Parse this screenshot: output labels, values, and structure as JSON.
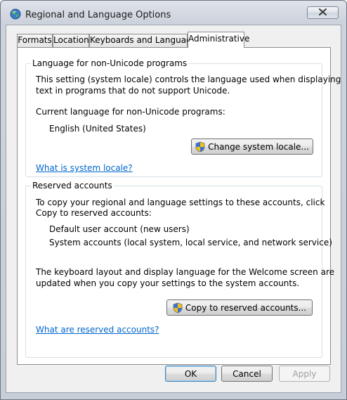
{
  "window": {
    "title": "Regional and Language Options"
  },
  "tabs": [
    {
      "label": "Formats"
    },
    {
      "label": "Location"
    },
    {
      "label": "Keyboards and Languages"
    },
    {
      "label": "Administrative"
    }
  ],
  "non_unicode": {
    "legend": "Language for non-Unicode programs",
    "description_line1": "This setting (system locale) controls the language used when displaying",
    "description_line2": "text in programs that do not support Unicode.",
    "current_label": "Current language for non-Unicode programs:",
    "current_value": "English (United States)",
    "change_button": "Change system locale...",
    "help_link": "What is system locale?"
  },
  "reserved": {
    "legend": "Reserved accounts",
    "description_line1": "To copy your regional and language settings to these accounts, click",
    "description_line2": "Copy to reserved accounts:",
    "account1": "Default user account (new users)",
    "account2": "System accounts (local system, local service, and network service)",
    "note_line1": "The keyboard layout and display language for the Welcome screen are",
    "note_line2": "updated when you copy your settings to the system accounts.",
    "copy_button": "Copy to reserved accounts...",
    "help_link": "What are reserved accounts?"
  },
  "footer": {
    "ok": "OK",
    "cancel": "Cancel",
    "apply": "Apply"
  },
  "icons": {
    "app": "globe-icon",
    "close": "close-icon",
    "uac": "uac-shield-icon"
  },
  "colors": {
    "link": "#0066cc",
    "group_border": "#d5dfe5",
    "disabled_text": "#a0a0a0"
  }
}
